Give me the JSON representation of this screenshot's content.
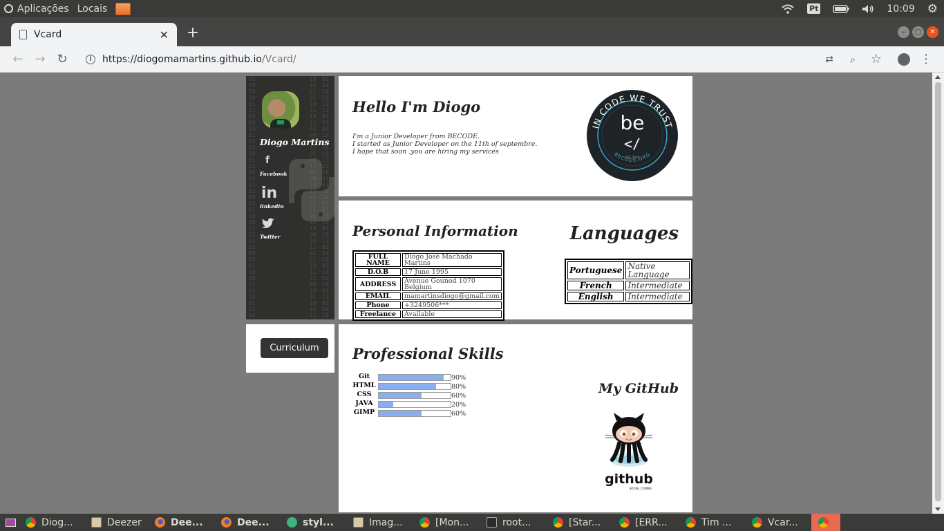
{
  "top_panel": {
    "menus": [
      "Aplicações",
      "Locais"
    ],
    "keyboard_layout": "Pt",
    "clock": "10:09"
  },
  "browser": {
    "tab_title": "Vcard",
    "url_host": "https://diogomamartins.github.io",
    "url_path": "/Vcard/"
  },
  "sidebar": {
    "name": "Diogo Martins",
    "social": [
      {
        "label": "Facebook",
        "icon": "facebook-icon"
      },
      {
        "label": "linkedin",
        "icon": "linkedin-icon"
      },
      {
        "label": "Twitter",
        "icon": "twitter-icon"
      }
    ],
    "curriculum_button": "Curriculum"
  },
  "hello": {
    "title": "Hello I'm Diogo",
    "lines": [
      "I'm a Junior Developer from BECODE.",
      "I started as Junior Developer on the 11th of septembre.",
      "I hope that soon ,you are hiring my services"
    ],
    "badge_text": {
      "top": "IN CODE WE TRUST",
      "logo": "be",
      "est": "EST. 2016",
      "bottom": "BECODE.ORG"
    }
  },
  "personal_info": {
    "title": "Personal Information",
    "rows": [
      {
        "key": "FULL NAME",
        "value": "Diogo José Machado Martins"
      },
      {
        "key": "D.O.B",
        "value": "17 June 1995"
      },
      {
        "key": "ADDRESS",
        "value": "Avenue Gounod 1070 Belgium"
      },
      {
        "key": "EMAIL",
        "value": "mamartinsdiogo@gmail.com"
      },
      {
        "key": "Phone",
        "value": "+3249506***"
      },
      {
        "key": "Freelance",
        "value": "Available"
      }
    ]
  },
  "languages": {
    "title": "Languages",
    "rows": [
      {
        "key": "Portuguese",
        "value": "Native Language"
      },
      {
        "key": "French",
        "value": "Intermediate"
      },
      {
        "key": "English",
        "value": "Intermediate"
      }
    ]
  },
  "skills": {
    "title": "Professional Skills",
    "items": [
      {
        "name": "Git",
        "percent": 90,
        "label": "90%"
      },
      {
        "name": "HTML",
        "percent": 80,
        "label": "80%"
      },
      {
        "name": "CSS",
        "percent": 60,
        "label": "60%"
      },
      {
        "name": "JAVA",
        "percent": 20,
        "label": "20%"
      },
      {
        "name": "GIMP",
        "percent": 60,
        "label": "60%"
      }
    ]
  },
  "github": {
    "title": "My GitHub",
    "logo_text": "github",
    "logo_subtext": "SOCIAL CODING"
  },
  "taskbar": {
    "tasks": [
      {
        "label": "Diog...",
        "icon": "chrome-icon",
        "bold": false
      },
      {
        "label": "Deezer",
        "icon": "app-window-icon",
        "bold": false
      },
      {
        "label": "Dee...",
        "icon": "firefox-icon",
        "bold": true
      },
      {
        "label": "Dee...",
        "icon": "firefox-icon",
        "bold": true
      },
      {
        "label": "styl...",
        "icon": "green-app-icon",
        "bold": true
      },
      {
        "label": "Imag...",
        "icon": "app-window-icon",
        "bold": false
      },
      {
        "label": "[Mon...",
        "icon": "chrome-icon",
        "bold": false
      },
      {
        "label": "root...",
        "icon": "terminal-icon",
        "bold": false
      },
      {
        "label": "[Star...",
        "icon": "chrome-icon",
        "bold": false
      },
      {
        "label": "[ERR...",
        "icon": "chrome-icon",
        "bold": false
      },
      {
        "label": "Tim ...",
        "icon": "chrome-icon",
        "bold": false
      },
      {
        "label": "Vcar...",
        "icon": "chrome-icon",
        "bold": false
      }
    ]
  },
  "colors": {
    "skill_fill": "#8aaff0",
    "sidebar_bg": "#2f2f2d",
    "badge_accent": "#3aa7c7"
  }
}
